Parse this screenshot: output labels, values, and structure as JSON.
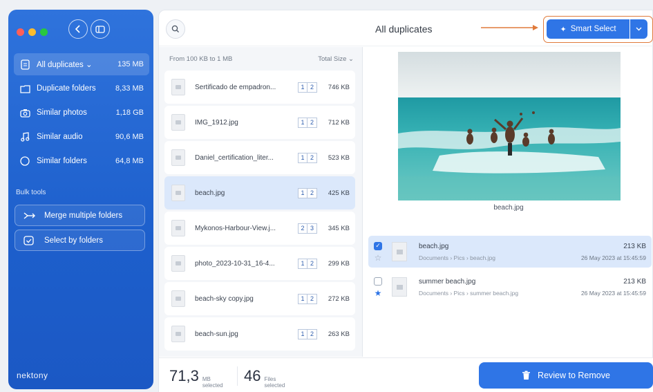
{
  "sidebar": {
    "items": [
      {
        "label": "All duplicates",
        "size": "135 MB",
        "icon": "document-icon"
      },
      {
        "label": "Duplicate folders",
        "size": "8,33 MB",
        "icon": "folder-icon"
      },
      {
        "label": "Similar photos",
        "size": "1,18 GB",
        "icon": "camera-icon"
      },
      {
        "label": "Similar audio",
        "size": "90,6 MB",
        "icon": "music-icon"
      },
      {
        "label": "Similar folders",
        "size": "64,8 MB",
        "icon": "compass-icon"
      }
    ],
    "bulk_title": "Bulk tools",
    "bulk_merge": "Merge multiple folders",
    "bulk_select": "Select by folders",
    "brand": "nektony"
  },
  "header": {
    "title": "All duplicates",
    "smart_select": "Smart Select"
  },
  "list": {
    "filter": "From 100 KB to 1 MB",
    "sort": "Total Size",
    "rows": [
      {
        "name": "Sertificado de empadron...",
        "a": "1",
        "b": "2",
        "size": "746 KB"
      },
      {
        "name": "IMG_1912.jpg",
        "a": "1",
        "b": "2",
        "size": "712 KB"
      },
      {
        "name": "Daniel_certification_liter...",
        "a": "1",
        "b": "2",
        "size": "523 KB"
      },
      {
        "name": "beach.jpg",
        "a": "1",
        "b": "2",
        "size": "425 KB"
      },
      {
        "name": "Mykonos-Harbour-View.j...",
        "a": "2",
        "b": "3",
        "size": "345 KB"
      },
      {
        "name": "photo_2023-10-31_16-4...",
        "a": "1",
        "b": "2",
        "size": "299 KB"
      },
      {
        "name": "beach-sky copy.jpg",
        "a": "1",
        "b": "2",
        "size": "272 KB"
      },
      {
        "name": "beach-sun.jpg",
        "a": "1",
        "b": "2",
        "size": "263 KB"
      }
    ]
  },
  "preview": {
    "caption": "beach.jpg",
    "files": [
      {
        "name": "beach.jpg",
        "path": "Documents › Pics › beach.jpg",
        "size": "213 KB",
        "date": "26 May 2023 at 15:45:59"
      },
      {
        "name": "summer beach.jpg",
        "path": "Documents › Pics › summer beach.jpg",
        "size": "213 KB",
        "date": "26 May 2023 at 15:45:59"
      }
    ]
  },
  "footer": {
    "size_value": "71,3",
    "size_unit": "MB",
    "size_label": "selected",
    "files_value": "46",
    "files_unit": "Files",
    "files_label": "selected",
    "review": "Review to Remove"
  },
  "colors": {
    "accent": "#2f75e6",
    "highlight": "#e07a3a",
    "sidebar": "#1d5fcc"
  }
}
